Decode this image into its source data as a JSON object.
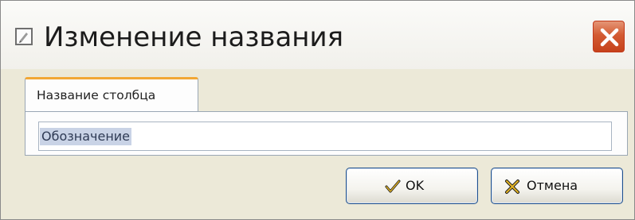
{
  "window": {
    "title": "Изменение названия",
    "title_icon": "edit-icon",
    "close_icon": "close-icon"
  },
  "tab": {
    "label": "Название столбца"
  },
  "field": {
    "value": "Обозначение"
  },
  "buttons": {
    "ok_label": "OK",
    "ok_icon": "checkmark-icon",
    "cancel_label": "Отмена",
    "cancel_icon": "cross-icon"
  },
  "colors": {
    "close_button": "#d35b33",
    "tab_accent": "#f2a735",
    "selection": "#c9d3e6",
    "button_border": "#1f4f8a"
  }
}
